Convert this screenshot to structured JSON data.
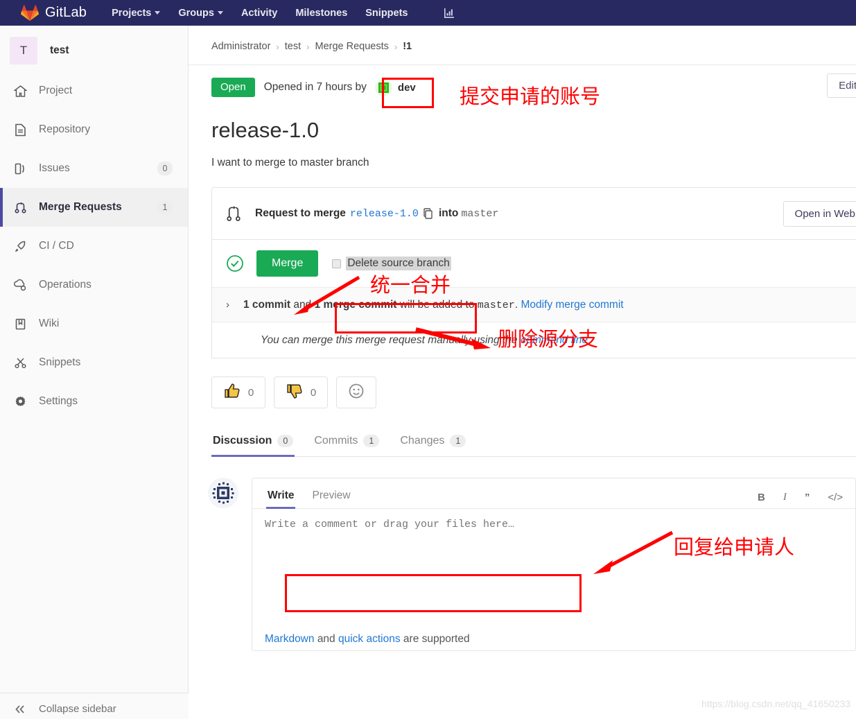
{
  "navbar": {
    "brand": "GitLab",
    "links": [
      {
        "label": "Projects",
        "caret": true
      },
      {
        "label": "Groups",
        "caret": true
      },
      {
        "label": "Activity",
        "caret": false
      },
      {
        "label": "Milestones",
        "caret": false
      },
      {
        "label": "Snippets",
        "caret": false
      }
    ],
    "chart_icon": "analytics-icon"
  },
  "sidebar": {
    "project_initial": "T",
    "project_name": "test",
    "items": [
      {
        "label": "Project",
        "icon": "home-icon",
        "badge": "",
        "active": false
      },
      {
        "label": "Repository",
        "icon": "file-icon",
        "badge": "",
        "active": false
      },
      {
        "label": "Issues",
        "icon": "issues-icon",
        "badge": "0",
        "active": false
      },
      {
        "label": "Merge Requests",
        "icon": "merge-request-icon",
        "badge": "1",
        "active": true
      },
      {
        "label": "CI / CD",
        "icon": "rocket-icon",
        "badge": "",
        "active": false
      },
      {
        "label": "Operations",
        "icon": "operations-icon",
        "badge": "",
        "active": false
      },
      {
        "label": "Wiki",
        "icon": "book-icon",
        "badge": "",
        "active": false
      },
      {
        "label": "Snippets",
        "icon": "scissors-icon",
        "badge": "",
        "active": false
      },
      {
        "label": "Settings",
        "icon": "gear-icon",
        "badge": "",
        "active": false
      }
    ],
    "collapse_label": "Collapse sidebar",
    "collapse_icon": "chevron-double-left-icon"
  },
  "breadcrumb": {
    "items": [
      "Administrator",
      "test",
      "Merge Requests",
      "!1"
    ],
    "separator": "›"
  },
  "status": {
    "badge": "Open",
    "opened_text": "Opened in 7 hours by",
    "author": "dev",
    "author_avatar": "identicon-avatar",
    "edit_label": "Edit"
  },
  "mr": {
    "title": "release-1.0",
    "description": "I want to merge to master branch"
  },
  "widget": {
    "icon": "merge-request-icon",
    "request_label": "Request to merge",
    "source_branch": "release-1.0",
    "copy_icon": "copy-icon",
    "into_label": "into",
    "target_branch": "master",
    "web_ide_label": "Open in Web IDE",
    "status_icon": "check-circle-icon",
    "merge_label": "Merge",
    "delete_source_branch_label": "Delete source branch",
    "delete_source_branch_checked": false,
    "commits_chevron": "›",
    "commits_strong_1": "1 commit",
    "commits_and": "and",
    "commits_strong_2": "1 merge commit",
    "commits_tail": "will be added to",
    "commits_target": "master",
    "commits_period": ".",
    "modify_link": "Modify merge commit",
    "manual_text": "You can merge this merge request manually using the",
    "manual_link": "command line"
  },
  "awards": [
    {
      "icon": "thumbs-up-icon",
      "count": "0",
      "name": "thumbsup"
    },
    {
      "icon": "thumbs-down-icon",
      "count": "0",
      "name": "thumbsdown"
    },
    {
      "icon": "add-reaction-icon",
      "count": "",
      "name": "add-reaction"
    }
  ],
  "tabs": [
    {
      "label": "Discussion",
      "badge": "0",
      "active": true
    },
    {
      "label": "Commits",
      "badge": "1",
      "active": false
    },
    {
      "label": "Changes",
      "badge": "1",
      "active": false
    }
  ],
  "comment": {
    "avatar": "user-identicon-avatar",
    "tabs": [
      {
        "label": "Write",
        "active": true
      },
      {
        "label": "Preview",
        "active": false
      }
    ],
    "placeholder": "Write a comment or drag your files here…",
    "value": "",
    "tools": [
      {
        "glyph": "B",
        "name": "bold-icon"
      },
      {
        "glyph": "I",
        "name": "italic-icon"
      },
      {
        "glyph": "”",
        "name": "quote-icon"
      },
      {
        "glyph": "</>",
        "name": "code-icon"
      }
    ],
    "footer_link_1": "Markdown",
    "footer_mid": "and",
    "footer_link_2": "quick actions",
    "footer_tail": "are supported"
  },
  "annotations": [
    {
      "id": "author",
      "text": "提交申请的账号"
    },
    {
      "id": "merge",
      "text": "统一合并"
    },
    {
      "id": "delete-branch",
      "text": "删除源分支"
    },
    {
      "id": "reply",
      "text": "回复给申请人"
    }
  ],
  "watermark": "https://blog.csdn.net/qq_41650233",
  "colors": {
    "navbar": "#292961",
    "accent": "#6b6bbd",
    "success": "#1aaa55",
    "link": "#1f78d1",
    "annotation": "#ff0000"
  }
}
